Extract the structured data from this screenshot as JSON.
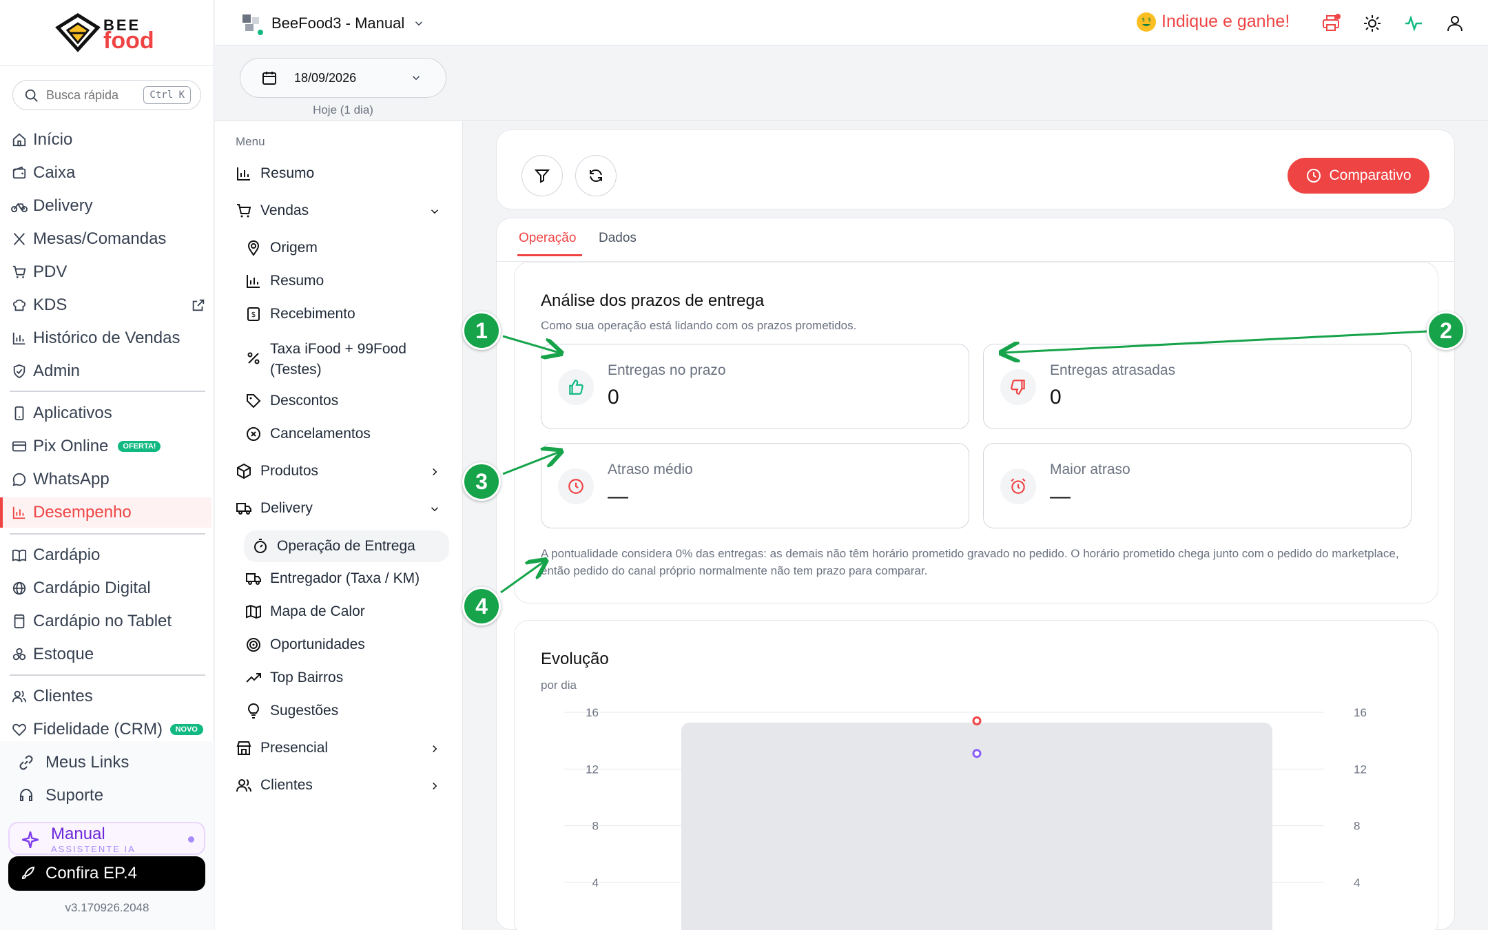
{
  "brand": {
    "bee": "BEE",
    "food": "food"
  },
  "search": {
    "placeholder": "Busca rápida",
    "shortcut": "Ctrl K"
  },
  "sidebar": {
    "items": [
      {
        "label": "Início",
        "icon": "home-icon"
      },
      {
        "label": "Caixa",
        "icon": "wallet-icon"
      },
      {
        "label": "Delivery",
        "icon": "bike-icon"
      },
      {
        "label": "Mesas/Comandas",
        "icon": "utensils-icon"
      },
      {
        "label": "PDV",
        "icon": "cart-icon"
      },
      {
        "label": "KDS",
        "icon": "chef-hat-icon"
      },
      {
        "label": "Histórico de Vendas",
        "icon": "bar-chart-icon"
      },
      {
        "label": "Admin",
        "icon": "shield-icon"
      },
      {
        "label": "Aplicativos",
        "icon": "phone-icon"
      },
      {
        "label": "Pix Online",
        "icon": "card-icon",
        "badge": "OFERTA!"
      },
      {
        "label": "WhatsApp",
        "icon": "chat-icon"
      },
      {
        "label": "Desempenho",
        "icon": "bar-chart-icon"
      },
      {
        "label": "Cardápio",
        "icon": "book-icon"
      },
      {
        "label": "Cardápio Digital",
        "icon": "globe-icon"
      },
      {
        "label": "Cardápio no Tablet",
        "icon": "tablet-icon"
      },
      {
        "label": "Estoque",
        "icon": "boxes-icon"
      },
      {
        "label": "Clientes",
        "icon": "users-icon"
      },
      {
        "label": "Fidelidade (CRM)",
        "icon": "heart-icon",
        "badge": "NOVO"
      }
    ],
    "bottom": [
      {
        "label": "Meus Links",
        "icon": "link-icon"
      },
      {
        "label": "Suporte",
        "icon": "headset-icon"
      }
    ],
    "assistant": {
      "title": "Manual",
      "subtitle": "ASSISTENTE IA"
    },
    "promo": "Confira EP.4",
    "version": "v3.170926.2048"
  },
  "topbar": {
    "store": "BeeFood3 - Manual",
    "refer": "Indique e ganhe!"
  },
  "date": {
    "value": "18/09/2026",
    "caption": "Hoje (1 dia)"
  },
  "menu2": {
    "heading": "Menu",
    "resumo": "Resumo",
    "vendas": "Vendas",
    "vendas_items": [
      "Origem",
      "Resumo",
      "Recebimento",
      "Taxa iFood + 99Food",
      "(Testes)",
      "Descontos",
      "Cancelamentos"
    ],
    "produtos": "Produtos",
    "delivery": "Delivery",
    "delivery_items": [
      "Operação de Entrega",
      "Entregador (Taxa / KM)",
      "Mapa de Calor",
      "Oportunidades",
      "Top Bairros",
      "Sugestões"
    ],
    "presencial": "Presencial",
    "clientes": "Clientes"
  },
  "main": {
    "compare_label": "Comparativo",
    "tabs": [
      "Operação",
      "Dados"
    ],
    "analysis": {
      "title": "Análise dos prazos de entrega",
      "subtitle": "Como sua operação está lidando com os prazos prometidos.",
      "metrics": [
        {
          "label": "Entregas no prazo",
          "value": "0"
        },
        {
          "label": "Entregas atrasadas",
          "value": "0"
        },
        {
          "label": "Atraso médio",
          "value": "—"
        },
        {
          "label": "Maior atraso",
          "value": "—"
        }
      ],
      "note": "A pontualidade considera 0% das entregas: as demais não têm horário prometido gravado no pedido. O horário prometido chega junto com o pedido do marketplace, então pedido do canal próprio normalmente não tem prazo para comparar."
    },
    "evolution": {
      "title": "Evolução",
      "subtitle": "por dia"
    }
  },
  "annotations": [
    "1",
    "2",
    "3",
    "4"
  ],
  "chart_data": {
    "type": "scatter",
    "title": "Evolução",
    "subtitle": "por dia",
    "y_ticks": [
      4,
      8,
      12,
      16
    ],
    "y2_ticks": [
      4,
      8,
      12,
      16
    ],
    "ylim": [
      0,
      16
    ],
    "grid": true,
    "series": [
      {
        "color": "#ef4444",
        "values": [
          15.4
        ]
      },
      {
        "color": "#8b5cf6",
        "values": [
          13.1
        ]
      }
    ],
    "colors": {
      "bar": "#e5e7eb"
    }
  },
  "colors": {
    "accent": "#ef4444",
    "annotation": "#16a34a"
  }
}
